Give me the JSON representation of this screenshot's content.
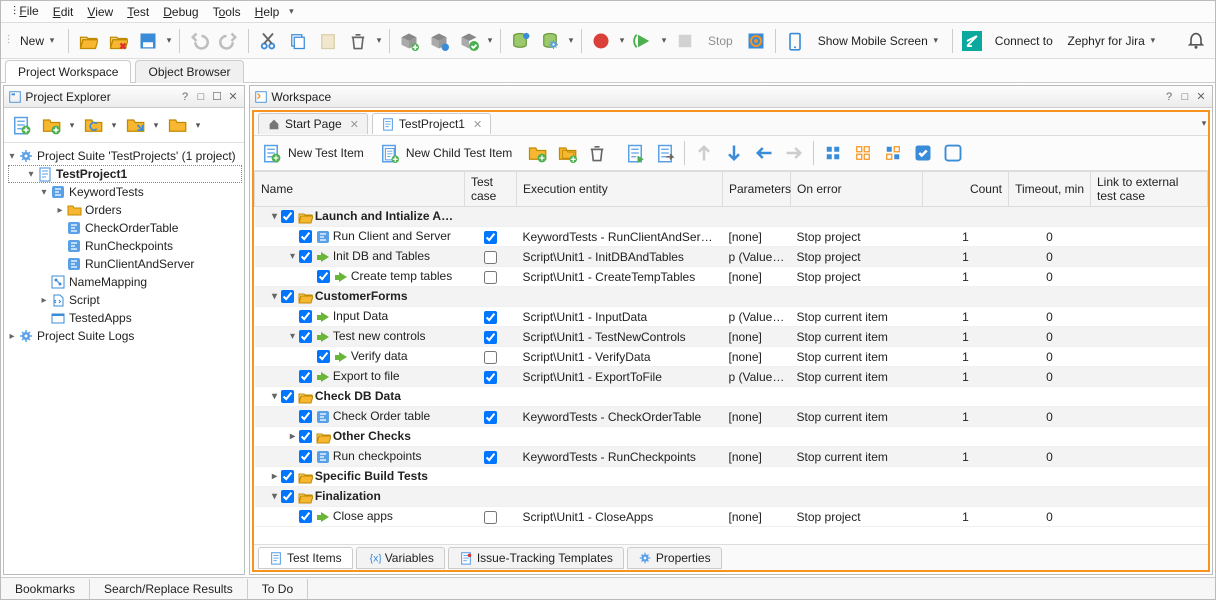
{
  "menus": [
    "File",
    "Edit",
    "View",
    "Test",
    "Debug",
    "Tools",
    "Help"
  ],
  "toolbar": {
    "new": "New",
    "stop": "Stop",
    "show_mobile": "Show Mobile Screen",
    "connect": "Connect to",
    "connect_target": "Zephyr for Jira"
  },
  "top_tabs": {
    "active": "Project Workspace",
    "other": "Object Browser"
  },
  "explorer": {
    "title": "Project Explorer",
    "suite": "Project Suite 'TestProjects' (1 project)",
    "project": "TestProject1",
    "nodes": {
      "kw": "KeywordTests",
      "orders": "Orders",
      "checkorder": "CheckOrderTable",
      "runcp": "RunCheckpoints",
      "runcs": "RunClientAndServer",
      "nm": "NameMapping",
      "script": "Script",
      "ta": "TestedApps",
      "logs": "Project Suite Logs"
    }
  },
  "workspace": {
    "title": "Workspace",
    "tabs": {
      "start": "Start Page",
      "proj": "TestProject1"
    },
    "btns": {
      "new": "New Test Item",
      "newchild": "New Child Test Item"
    },
    "cols": {
      "name": "Name",
      "tc": "Test case",
      "exec": "Execution entity",
      "param": "Parameters",
      "err": "On error",
      "count": "Count",
      "timeout": "Timeout, min",
      "link": "Link to external test case"
    },
    "items": [
      {
        "d": 0,
        "exp": "▾",
        "g": true,
        "n": "Launch and Intialize Applications"
      },
      {
        "d": 1,
        "ic": "kw",
        "n": "Run Client and Server",
        "tc": true,
        "e": "KeywordTests - RunClientAndServer",
        "p": "[none]",
        "err": "Stop project",
        "c": "1",
        "t": "0"
      },
      {
        "d": 1,
        "exp": "▾",
        "ic": "sc",
        "n": "Init DB and Tables",
        "tc": false,
        "e": "Script\\Unit1 - InitDBAndTables",
        "p": "p (Value = ...",
        "err": "Stop project",
        "c": "1",
        "t": "0"
      },
      {
        "d": 2,
        "ic": "sc",
        "n": "Create temp tables",
        "tc": false,
        "e": "Script\\Unit1 - CreateTempTables",
        "p": "[none]",
        "err": "Stop project",
        "c": "1",
        "t": "0"
      },
      {
        "d": 0,
        "exp": "▾",
        "g": true,
        "n": "CustomerForms"
      },
      {
        "d": 1,
        "ic": "sc",
        "n": "Input Data",
        "tc": true,
        "e": "Script\\Unit1 - InputData",
        "p": "p (Value = ...",
        "err": "Stop current item",
        "c": "1",
        "t": "0"
      },
      {
        "d": 1,
        "exp": "▾",
        "ic": "sc",
        "n": "Test new controls",
        "tc": true,
        "e": "Script\\Unit1 - TestNewControls",
        "p": "[none]",
        "err": "Stop current item",
        "c": "1",
        "t": "0"
      },
      {
        "d": 2,
        "ic": "sc",
        "n": "Verify data",
        "tc": false,
        "e": "Script\\Unit1 - VerifyData",
        "p": "[none]",
        "err": "Stop current item",
        "c": "1",
        "t": "0"
      },
      {
        "d": 1,
        "ic": "sc",
        "n": "Export to file",
        "tc": true,
        "e": "Script\\Unit1 - ExportToFile",
        "p": "p (Value = ...",
        "err": "Stop current item",
        "c": "1",
        "t": "0"
      },
      {
        "d": 0,
        "exp": "▾",
        "g": true,
        "n": "Check DB Data"
      },
      {
        "d": 1,
        "ic": "kw",
        "n": "Check Order table",
        "tc": true,
        "e": "KeywordTests - CheckOrderTable",
        "p": "[none]",
        "err": "Stop current item",
        "c": "1",
        "t": "0"
      },
      {
        "d": 1,
        "exp": "▸",
        "g": true,
        "n": "Other Checks"
      },
      {
        "d": 1,
        "ic": "kw",
        "n": "Run checkpoints",
        "tc": true,
        "e": "KeywordTests - RunCheckpoints",
        "p": "[none]",
        "err": "Stop current item",
        "c": "1",
        "t": "0"
      },
      {
        "d": 0,
        "exp": "▸",
        "g": true,
        "n": "Specific Build Tests"
      },
      {
        "d": 0,
        "exp": "▾",
        "g": true,
        "n": "Finalization"
      },
      {
        "d": 1,
        "ic": "sc",
        "n": "Close apps",
        "tc": false,
        "e": "Script\\Unit1 - CloseApps",
        "p": "[none]",
        "err": "Stop project",
        "c": "1",
        "t": "0"
      }
    ],
    "bottom_tabs": {
      "ti": "Test Items",
      "vars": "Variables",
      "issue": "Issue-Tracking Templates",
      "props": "Properties"
    }
  },
  "status": {
    "bm": "Bookmarks",
    "sr": "Search/Replace Results",
    "td": "To Do"
  }
}
